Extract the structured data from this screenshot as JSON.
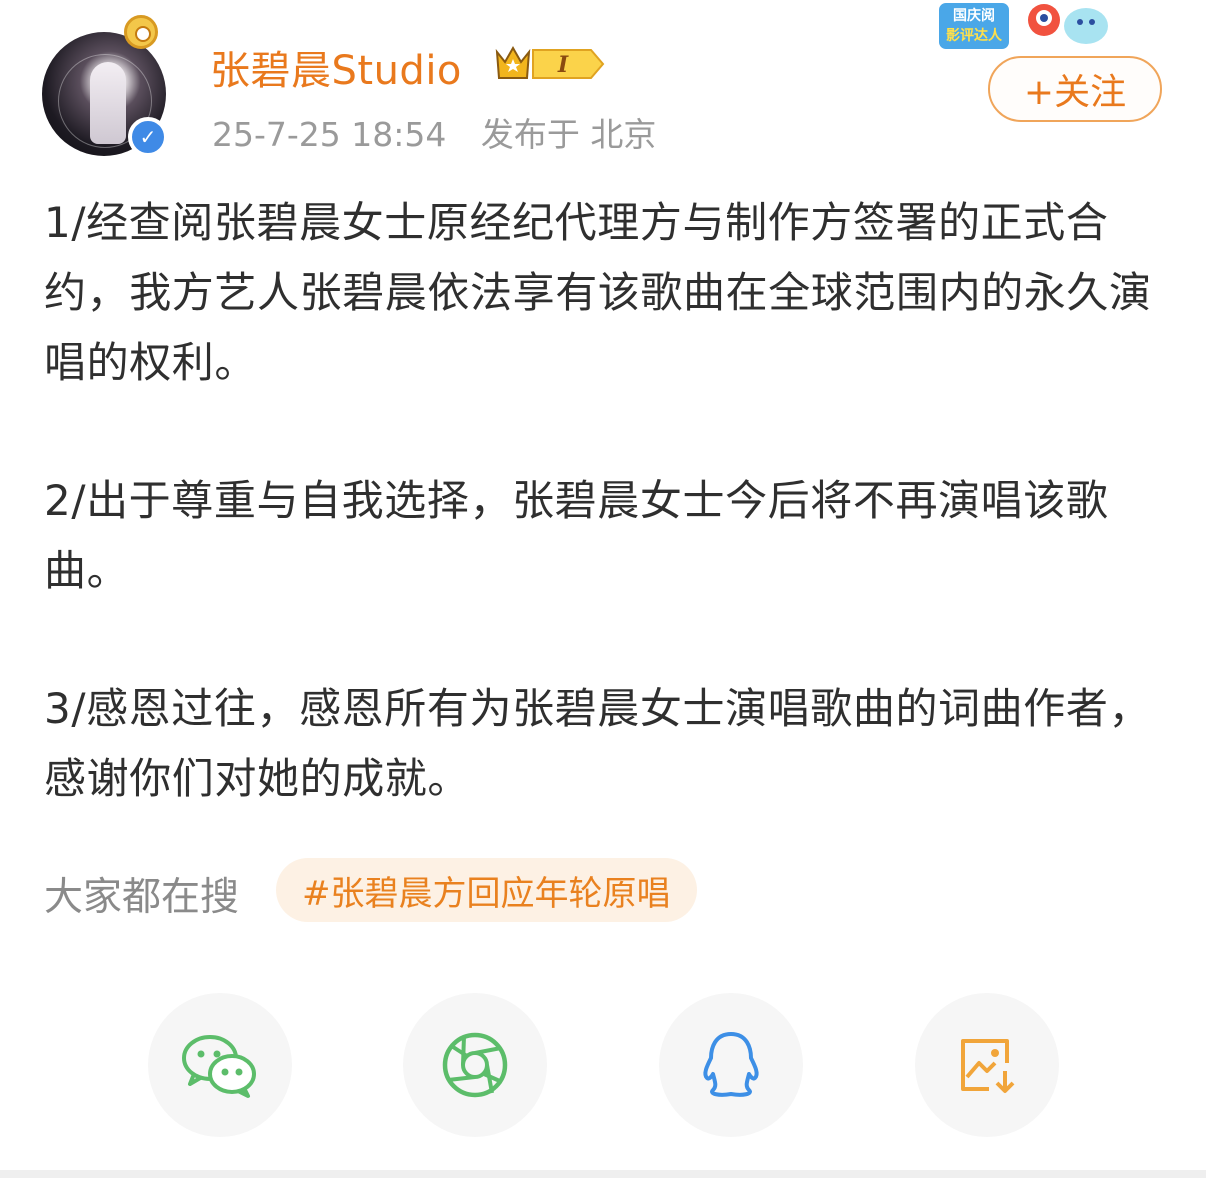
{
  "header": {
    "username": "张碧晨Studio",
    "vip_badge_text": "I",
    "post_date": "25-7-25 18:54",
    "post_location": "发布于 北京",
    "event_sticker_text": [
      "国庆阅",
      "影评达人"
    ],
    "follow_label": "+关注"
  },
  "post": {
    "paragraphs": [
      "1/经查阅张碧晨女士原经纪代理方与制作方签署的正式合约，我方艺人张碧晨依法享有该歌曲在全球范围内的永久演唱的权利。",
      "2/出于尊重与自我选择，张碧晨女士今后将不再演唱该歌曲。",
      "3/感恩过往，感恩所有为张碧晨女士演唱歌曲的词曲作者，感谢你们对她的成就。"
    ]
  },
  "trending": {
    "label": "大家都在搜",
    "hashtag": "#张碧晨方回应年轮原唱"
  },
  "share": {
    "buttons": [
      {
        "icon": "wechat-icon",
        "color": "#5cbd6a"
      },
      {
        "icon": "moments-icon",
        "color": "#5cbd6a"
      },
      {
        "icon": "qq-icon",
        "color": "#3d8fe6"
      },
      {
        "icon": "save-image-icon",
        "color": "#f1a53a"
      }
    ]
  },
  "colors": {
    "accent_orange": "#e9791d",
    "verify_blue": "#3f8ae6"
  }
}
